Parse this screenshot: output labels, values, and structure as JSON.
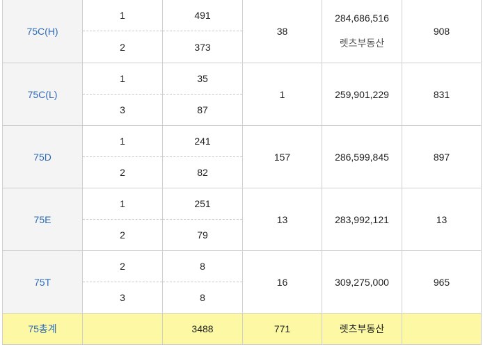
{
  "rows": [
    {
      "type": "75C(H)",
      "subs": [
        {
          "floor": "1",
          "count": "491"
        },
        {
          "floor": "2",
          "count": "373"
        }
      ],
      "households": "38",
      "price": "284,686,516",
      "note": "렛츠부동산",
      "last": "908"
    },
    {
      "type": "75C(L)",
      "subs": [
        {
          "floor": "1",
          "count": "35"
        },
        {
          "floor": "3",
          "count": "87"
        }
      ],
      "households": "1",
      "price": "259,901,229",
      "note": "",
      "last": "831"
    },
    {
      "type": "75D",
      "subs": [
        {
          "floor": "1",
          "count": "241"
        },
        {
          "floor": "2",
          "count": "82"
        }
      ],
      "households": "157",
      "price": "286,599,845",
      "note": "",
      "last": "897"
    },
    {
      "type": "75E",
      "subs": [
        {
          "floor": "1",
          "count": "251"
        },
        {
          "floor": "2",
          "count": "79"
        }
      ],
      "households": "13",
      "price": "283,992,121",
      "note": "",
      "last": "13"
    },
    {
      "type": "75T",
      "subs": [
        {
          "floor": "2",
          "count": "8"
        },
        {
          "floor": "3",
          "count": "8"
        }
      ],
      "households": "16",
      "price": "309,275,000",
      "note": "",
      "last": "965"
    }
  ],
  "total": {
    "label": "75총계",
    "floor": "",
    "count": "3488",
    "households": "771",
    "note": "렛츠부동산",
    "last": ""
  },
  "colors": {
    "type_text": "#2e6bb8",
    "type_bg": "#f4f4f4",
    "total_bg": "#fdf8a4",
    "border": "#cfcfcf"
  }
}
